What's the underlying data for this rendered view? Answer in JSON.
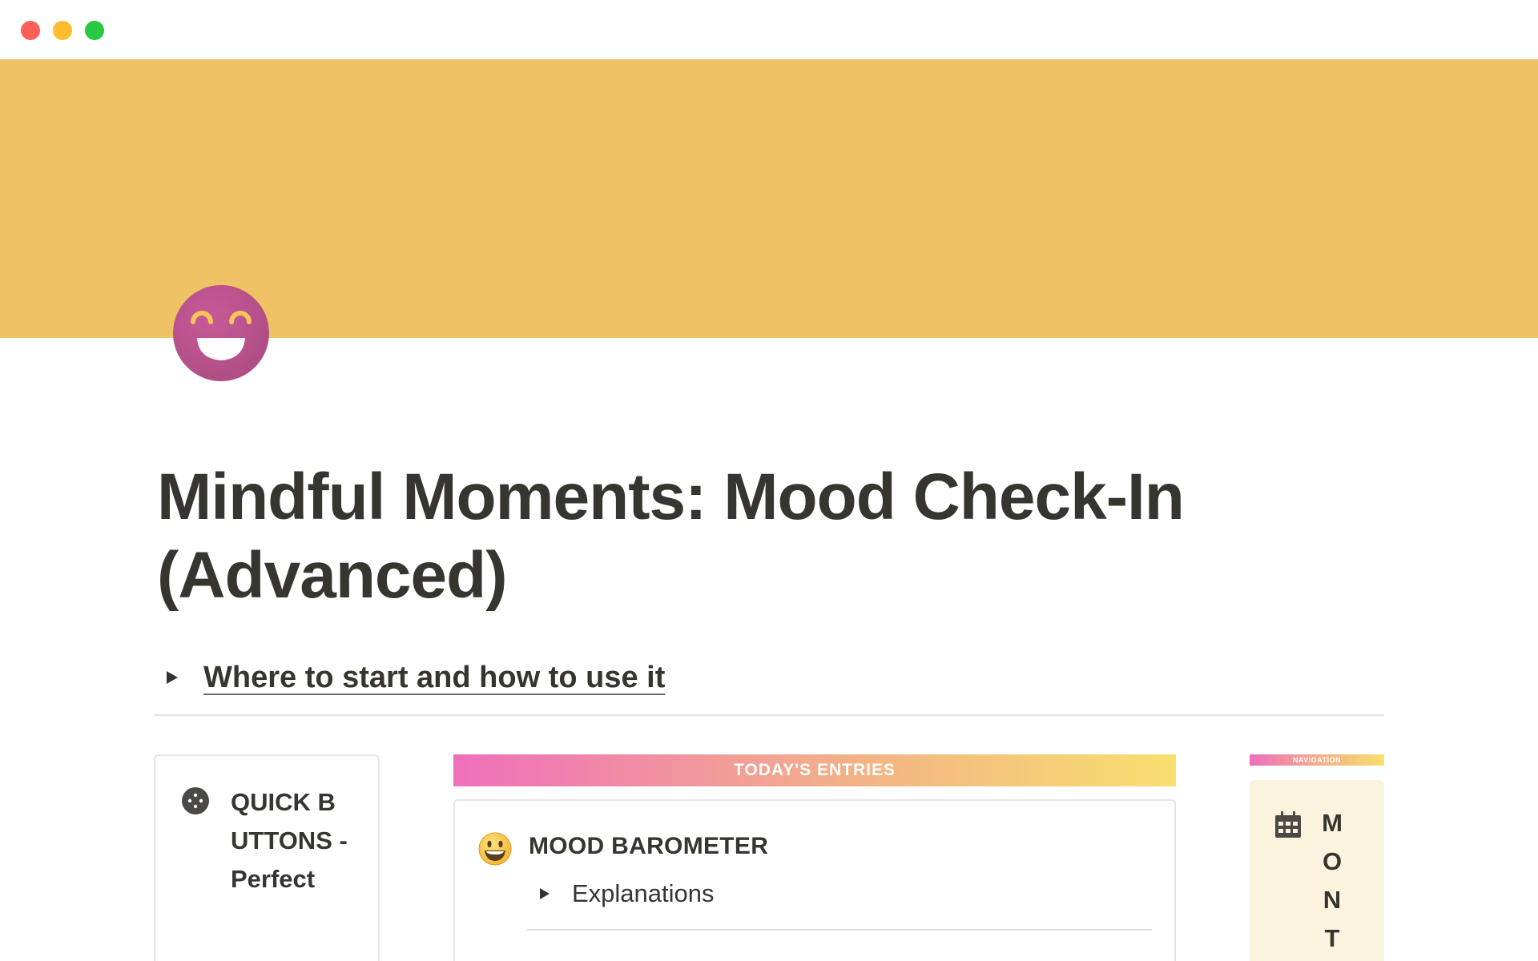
{
  "window": {
    "controls": [
      "close",
      "minimize",
      "zoom"
    ]
  },
  "cover": {
    "color": "#f0c266"
  },
  "page": {
    "icon": "grinning-face-icon",
    "title": "Mindful Moments: Mood Check-In (Advanced)",
    "toggle_link": "Where to start and how to use it"
  },
  "quick_buttons": {
    "icon": "cookie-icon",
    "label": "QUICK BUTTONS - Perfect"
  },
  "todays_entries": {
    "header": "TODAY'S ENTRIES",
    "mood_barometer": {
      "icon": "smiley-emoji-icon",
      "title": "MOOD BAROMETER",
      "toggle": "Explanations"
    }
  },
  "navigation": {
    "header": "NAVIGATION",
    "icon": "calendar-icon",
    "letters": [
      "M",
      "O",
      "N",
      "T"
    ]
  },
  "colors": {
    "text": "#37352f",
    "cover": "#f0c266",
    "icon_pink": "#b04f88",
    "gradient_start": "#ef6fbc",
    "gradient_end": "#f8df6f",
    "nav_card": "#fbf3de"
  }
}
